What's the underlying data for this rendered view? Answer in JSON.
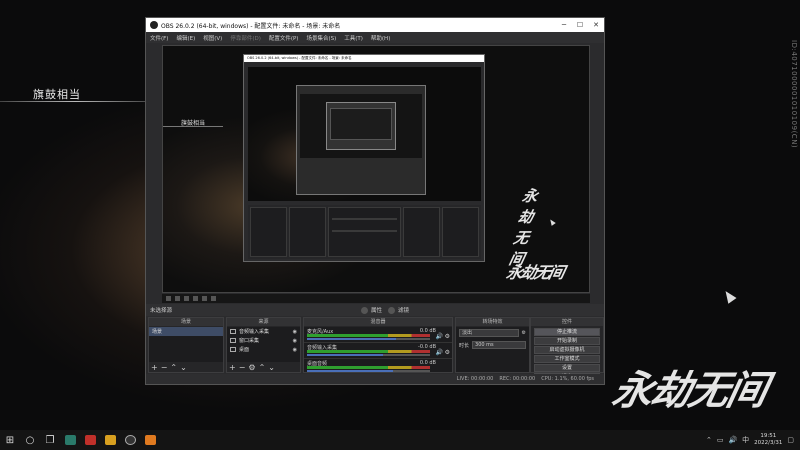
{
  "background_game": {
    "title": "旗鼓相当",
    "side_id": "ID:4071000001010109(CN)",
    "watermark": "永劫无间"
  },
  "obs": {
    "title": "OBS 26.0.2 (64-bit, windows) - 配置文件: 未命名 - 场景: 未命名",
    "menu": [
      "文件(F)",
      "编辑(E)",
      "视图(V)",
      "停靠部件(D)",
      "配置文件(P)",
      "场景集合(S)",
      "工具(T)",
      "帮助(H)"
    ],
    "preview": {
      "inner_title": "旗鼓相当",
      "nested_title": "OBS 26.0.2 (64-bit, windows) - 配置文件: 未命名 - 场景: 未命名",
      "watermark_medium": "永劫无间",
      "watermark_small": "永劫无间"
    },
    "scene_strip": {
      "no_source": "未选择源",
      "properties": "属性",
      "filters": "滤镜"
    },
    "docks": {
      "scenes": {
        "title": "场景",
        "items": [
          "场景"
        ]
      },
      "sources": {
        "title": "来源",
        "items": [
          {
            "name": "音频输入采集",
            "icon": "mic-icon"
          },
          {
            "name": "窗口采集",
            "icon": "window-icon"
          },
          {
            "name": "桌面",
            "icon": "monitor-icon"
          }
        ]
      },
      "mixer": {
        "title": "混音器",
        "channels": [
          {
            "name": "麦克风/Aux",
            "db": "0.0 dB",
            "level": 0.72
          },
          {
            "name": "音频输入采集",
            "db": "-0.0 dB",
            "level": 0.62
          },
          {
            "name": "桌面音频",
            "db": "0.0 dB",
            "level": 0.7
          }
        ]
      },
      "transitions": {
        "title": "转场特效",
        "type": "淡出",
        "duration_label": "时长",
        "duration": "300 ms"
      },
      "controls": {
        "title": "控件",
        "buttons": [
          "停止推流",
          "开始录制",
          "启动虚拟摄像机",
          "工作室模式",
          "设置",
          "退出"
        ]
      }
    },
    "status": {
      "live": "LIVE: 00:00:00",
      "rec": "REC: 00:00:00",
      "cpu": "CPU: 1.1%, 60.00 fps"
    }
  },
  "taskbar": {
    "apps": [
      "search-icon",
      "task-view-icon",
      "store-icon",
      "app-red-icon",
      "app-yellow-icon",
      "obs-icon",
      "app-orange-icon"
    ],
    "clock_time": "19:51",
    "clock_date": "2022/3/31"
  }
}
